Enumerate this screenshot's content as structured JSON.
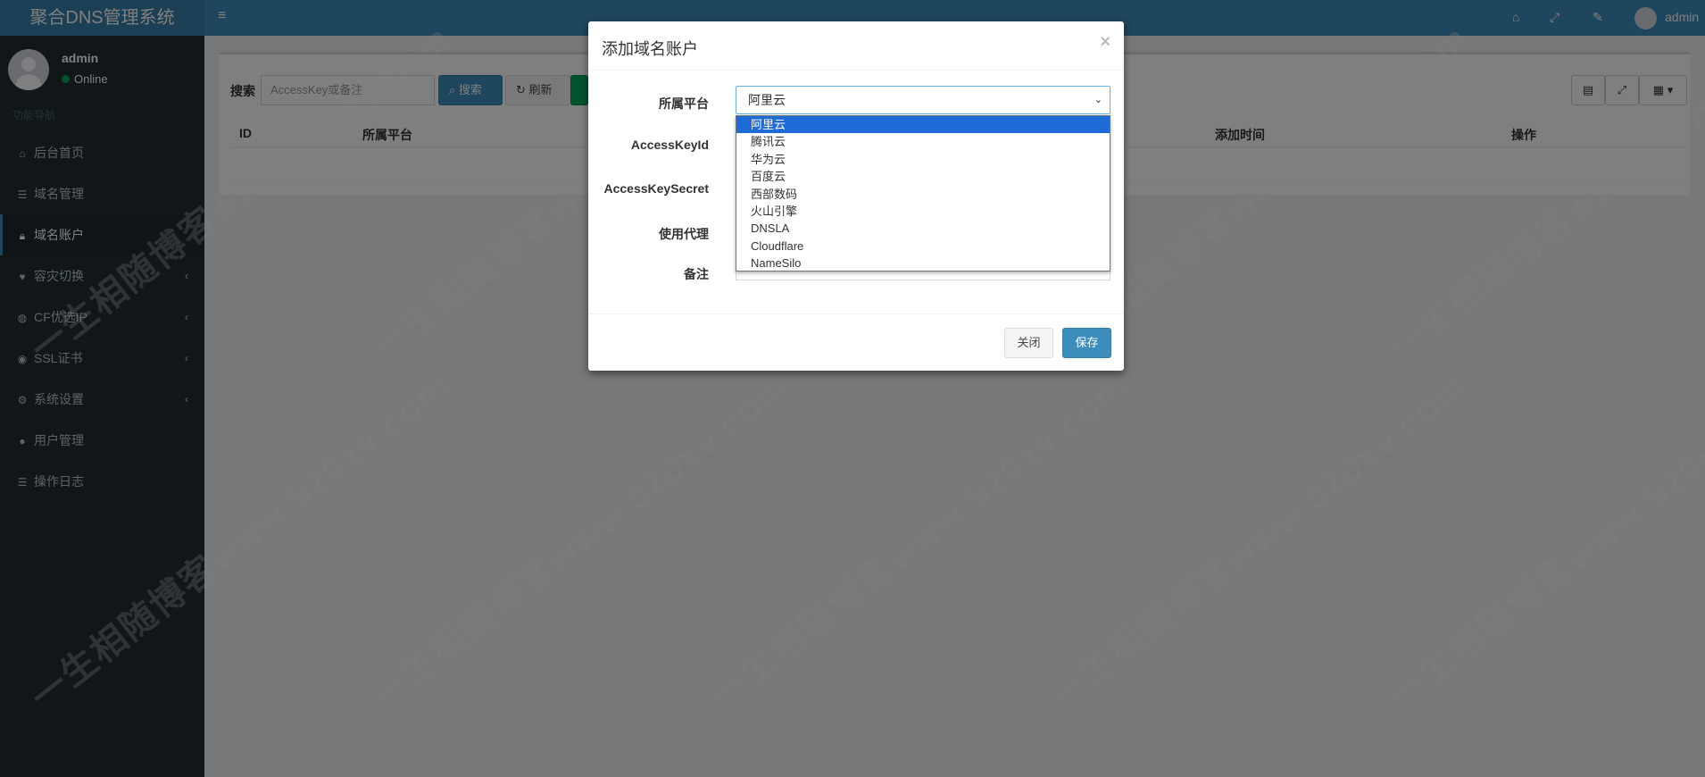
{
  "app": {
    "title": "聚合DNS管理系统",
    "user_name": "admin",
    "status": "Online",
    "nav_header": "功能导航"
  },
  "sidebar": {
    "items": [
      {
        "label": "后台首页",
        "icon": "home-icon",
        "arrow": false
      },
      {
        "label": "域名管理",
        "icon": "list-icon",
        "arrow": false
      },
      {
        "label": "域名账户",
        "icon": "lock-icon",
        "arrow": false,
        "active": true
      },
      {
        "label": "容灾切换",
        "icon": "heartbeat-icon",
        "arrow": true
      },
      {
        "label": "CF优选IP",
        "icon": "globe-icon",
        "arrow": true
      },
      {
        "label": "SSL证书",
        "icon": "certificate-icon",
        "arrow": true
      },
      {
        "label": "系统设置",
        "icon": "gears-icon",
        "arrow": true
      },
      {
        "label": "用户管理",
        "icon": "user-icon",
        "arrow": false
      },
      {
        "label": "操作日志",
        "icon": "list-icon",
        "arrow": false
      }
    ]
  },
  "navbar": {
    "toggle_glyph": "≡",
    "user": "admin"
  },
  "content": {
    "search_label": "搜索",
    "search_placeholder": "AccessKey或备注",
    "search_button": "搜索",
    "refresh_button": "刷新",
    "table_headers": [
      "ID",
      "所属平台",
      "添加时间",
      "操作"
    ]
  },
  "modal": {
    "title": "添加域名账户",
    "close_glyph": "×",
    "labels": {
      "platform": "所属平台",
      "access_key_id": "AccessKeyId",
      "access_key_secret": "AccessKeySecret",
      "proxy": "使用代理",
      "remark": "备注"
    },
    "selected_platform": "阿里云",
    "options": [
      "阿里云",
      "腾讯云",
      "华为云",
      "百度云",
      "西部数码",
      "火山引擎",
      "DNSLA",
      "Cloudflare",
      "NameSilo"
    ],
    "close_button": "关闭",
    "save_button": "保存"
  },
  "watermark": {
    "text": "一生相随博客www.520xv.com"
  },
  "colors": {
    "sidebar_bg": "#222d32",
    "navbar_bg": "#3c8dbc",
    "primary": "#3c8dbc",
    "success": "#00a65a",
    "option_selected": "#1e6ad6"
  }
}
